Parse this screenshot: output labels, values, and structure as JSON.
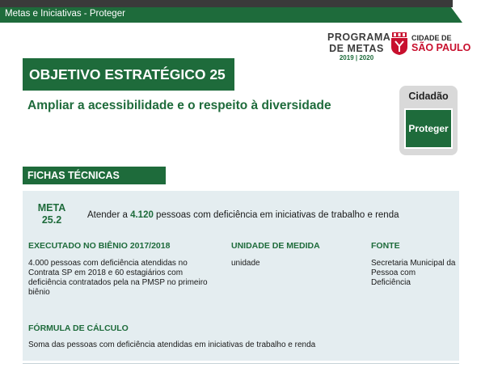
{
  "banner": {
    "title": "Metas e Iniciativas - Proteger"
  },
  "logos": {
    "programa_line1": "PROGRAMA",
    "programa_line2": "DE METAS",
    "programa_years": "2019 | 2020",
    "cidade_line1": "CIDADE DE",
    "cidade_line2": "SÃO PAULO"
  },
  "objective": {
    "title": "OBJETIVO ESTRATÉGICO 25",
    "subtitle": "Ampliar a acessibilidade e o respeito à diversidade"
  },
  "axis": {
    "label": "Cidadão",
    "button": "Proteger"
  },
  "fichas": {
    "title": "FICHAS TÉCNICAS",
    "meta_label_1": "META",
    "meta_label_2": "25.2",
    "meta_text_pre": "Atender a ",
    "meta_number": "4.120",
    "meta_text_post": " pessoas com deficiência em iniciativas de trabalho e renda",
    "executado_head": "EXECUTADO NO BIÊNIO 2017/2018",
    "executado_body": "4.000 pessoas com deficiência atendidas no Contrata SP em 2018 e 60 estagiários com deficiência contratados pela na PMSP no primeiro biênio",
    "unidade_head": "UNIDADE DE MEDIDA",
    "unidade_body": "unidade",
    "fonte_head": "FONTE",
    "fonte_body": "Secretaria Municipal da Pessoa com Deficiência",
    "formula_head": "FÓRMULA DE CÁLCULO",
    "formula_body": "Soma das pessoas com deficiência atendidas em iniciativas de trabalho e renda"
  },
  "colors": {
    "brand_green": "#1e6b3b",
    "panel_bg": "#e4edf0",
    "red": "#c8102e"
  }
}
